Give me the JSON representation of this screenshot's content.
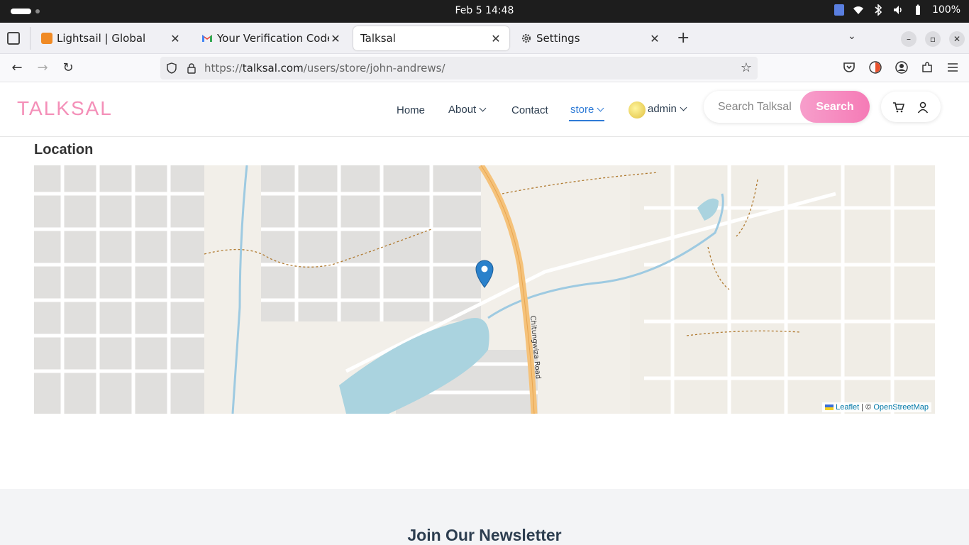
{
  "os": {
    "clock": "Feb 5  14:48",
    "battery": "100%"
  },
  "tabs": [
    {
      "label": "Lightsail | Global"
    },
    {
      "label": "Your Verification Code - I"
    },
    {
      "label": "Talksal"
    },
    {
      "label": "Settings"
    }
  ],
  "nav": {
    "url_scheme": "https://",
    "url_host": "talksal.com",
    "url_path": "/users/store/john-andrews/"
  },
  "site": {
    "logo": "TALKSAL",
    "menu": {
      "home": "Home",
      "about": "About",
      "contact": "Contact",
      "store": "store",
      "user": "admin"
    },
    "search_placeholder": "Search Talksal",
    "search_button": "Search"
  },
  "content": {
    "location_title": "Location",
    "map": {
      "road_label": "Chitungwiza Road",
      "attribution_leaflet": "Leaflet",
      "attribution_sep": " | © ",
      "attribution_osm": "OpenStreetMap"
    },
    "newsletter_title": "Join Our Newsletter"
  },
  "colors": {
    "brand_pink": "#f48fb8",
    "link_blue": "#2f7bd6",
    "marker_blue": "#2a81cb"
  }
}
